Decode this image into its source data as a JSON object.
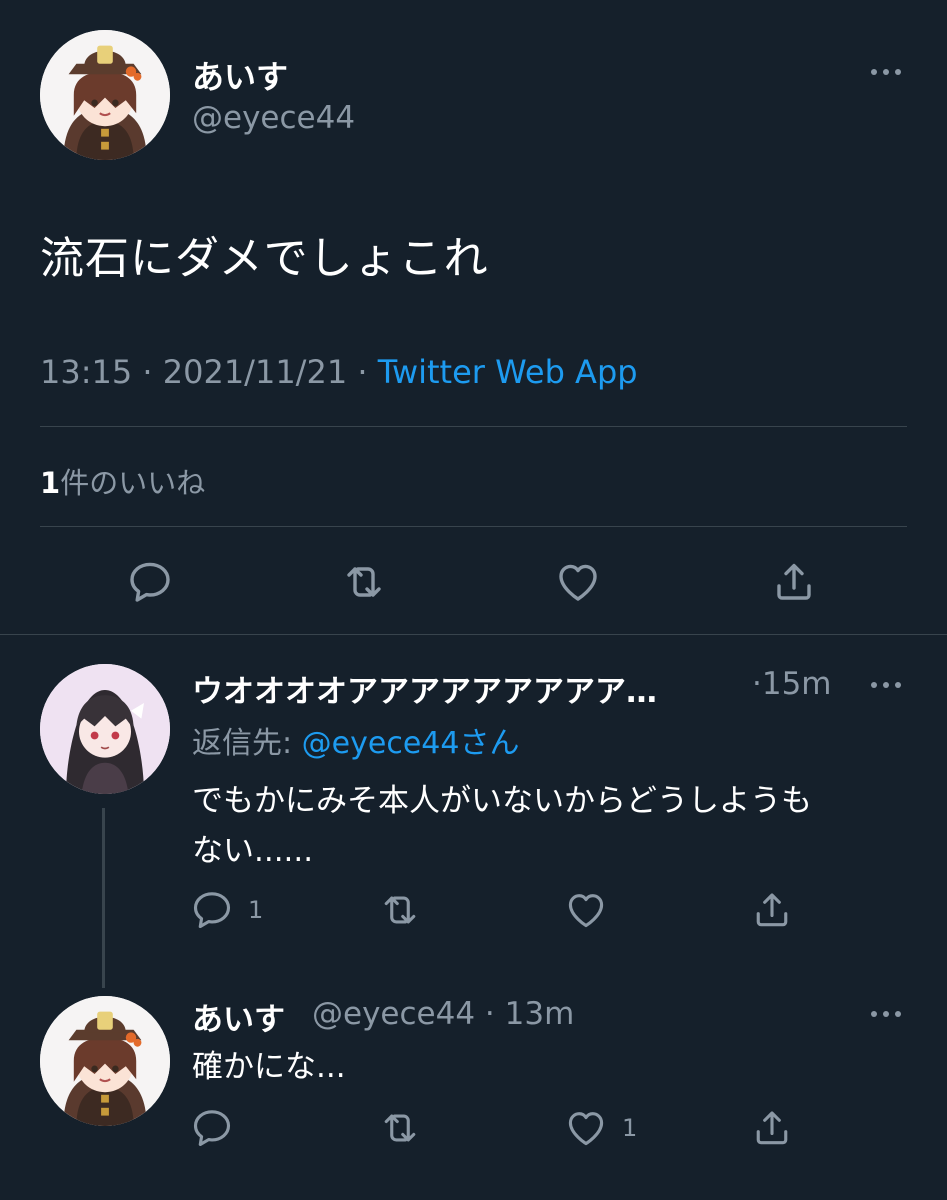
{
  "main_tweet": {
    "display_name": "あいす",
    "handle": "@eyece44",
    "text": "流石にダメでしょこれ",
    "time": "13:15",
    "date": "2021/11/21",
    "separator": " · ",
    "source": "Twitter Web App",
    "like_count": "1",
    "like_label": "件のいいね"
  },
  "replies": [
    {
      "display_name": "ウオオオオアアアアアアアアア…",
      "time": "15m",
      "time_prefix": "·",
      "reply_to_label": "返信先: ",
      "reply_to_handle": "@eyece44さん",
      "text_line1": "でもかにみそ本人がいないからどうしようも",
      "text_line2": "ない......",
      "reply_count": "1",
      "like_count": ""
    },
    {
      "display_name": "あいす",
      "handle": "@eyece44",
      "time": "· 13m",
      "text": "確かにな...",
      "reply_count": "",
      "like_count": "1"
    }
  ],
  "icons": {
    "more": "more-horizontal-icon",
    "reply": "speech-bubble-icon",
    "retweet": "retweet-arrows-icon",
    "like": "heart-icon",
    "share": "share-upload-icon"
  },
  "colors": {
    "background": "#15202b",
    "link": "#1d9bf0",
    "secondary_text": "#8b98a5",
    "divider": "#38444d"
  }
}
